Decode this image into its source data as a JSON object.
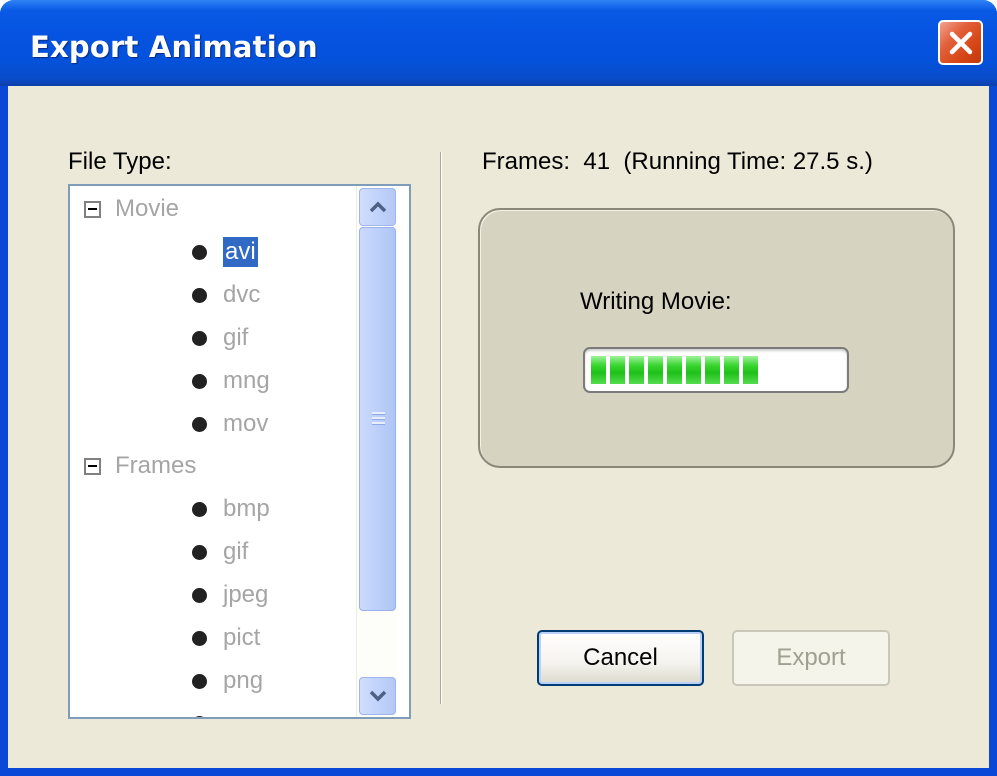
{
  "window": {
    "title": "Export Animation"
  },
  "file_type": {
    "label": "File Type:",
    "groups": [
      {
        "name": "Movie",
        "items": [
          "avi",
          "dvc",
          "gif",
          "mng",
          "mov"
        ],
        "selected": "avi"
      },
      {
        "name": "Frames",
        "items": [
          "bmp",
          "gif",
          "jpeg",
          "pict",
          "png"
        ]
      }
    ]
  },
  "frames": {
    "label": "Frames:",
    "count": "41",
    "running_time": "(Running Time: 27.5 s.)"
  },
  "progress": {
    "label": "Writing Movie:",
    "segments_filled": 9,
    "fraction": 0.72
  },
  "buttons": {
    "cancel": "Cancel",
    "export": "Export"
  },
  "colors": {
    "title_bar": "#0553e0",
    "selection": "#316ac5",
    "progress": "#1fc01a"
  },
  "icons": {
    "close": "close-icon",
    "scroll_up": "chevron-up-icon",
    "scroll_down": "chevron-down-icon"
  }
}
